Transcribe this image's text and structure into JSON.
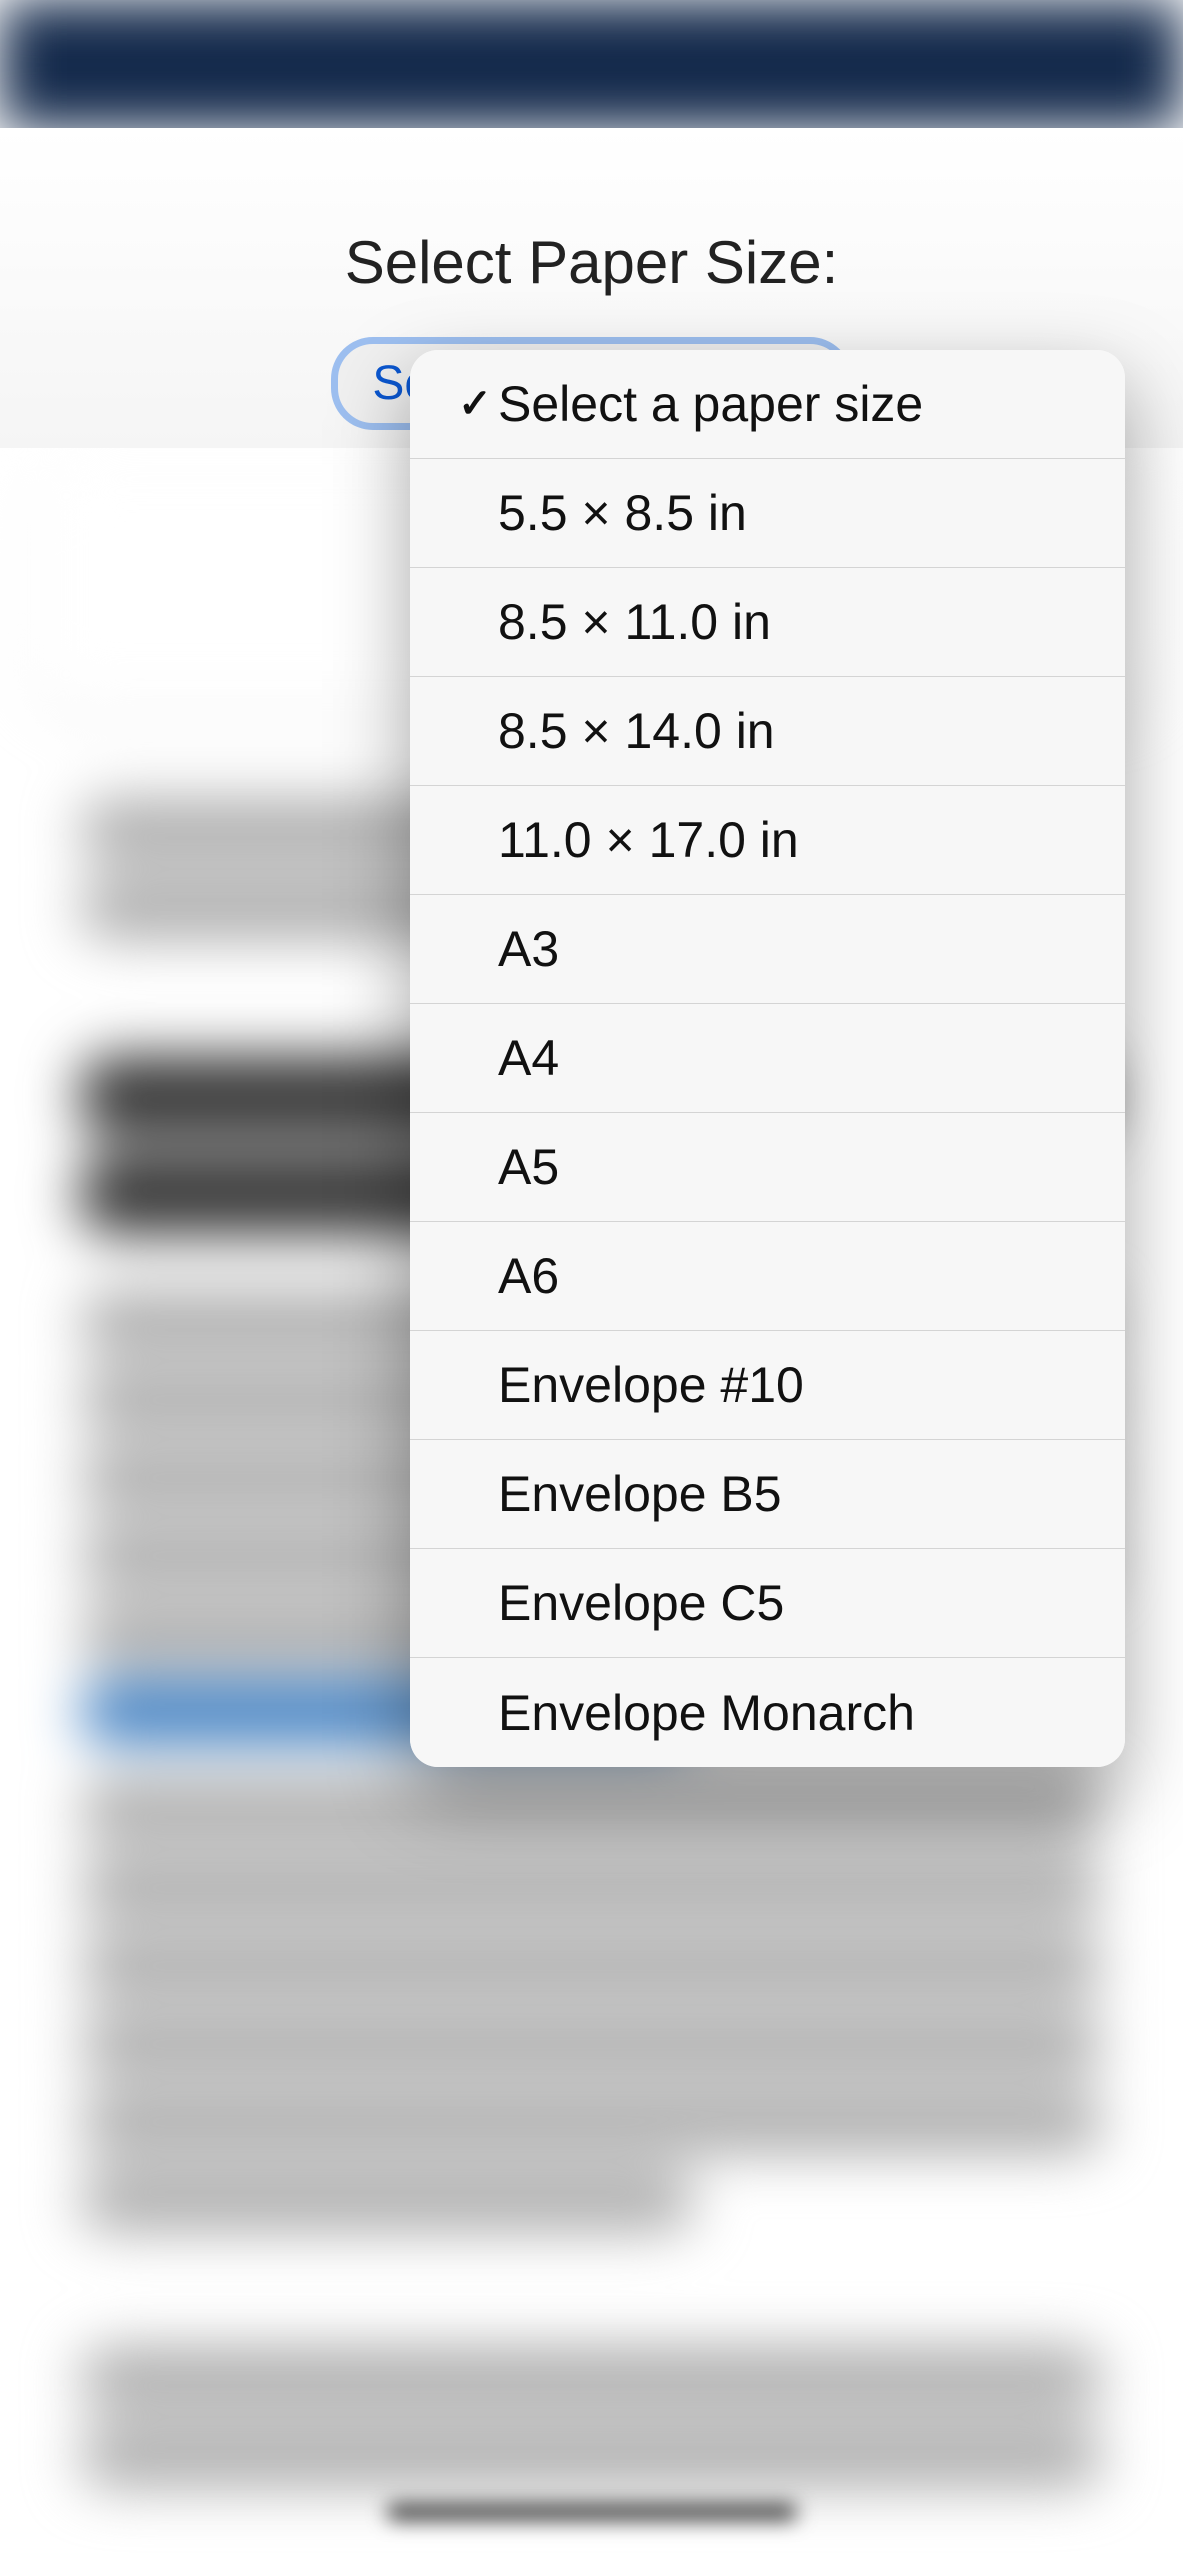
{
  "label": "Select Paper Size:",
  "selectButton": {
    "text": "Select a paper size"
  },
  "options": [
    {
      "label": "Select a paper size",
      "selected": true
    },
    {
      "label": "5.5 × 8.5 in",
      "selected": false
    },
    {
      "label": "8.5 × 11.0 in",
      "selected": false
    },
    {
      "label": "8.5 × 14.0 in",
      "selected": false
    },
    {
      "label": "11.0 × 17.0 in",
      "selected": false
    },
    {
      "label": "A3",
      "selected": false
    },
    {
      "label": "A4",
      "selected": false
    },
    {
      "label": "A5",
      "selected": false
    },
    {
      "label": "A6",
      "selected": false
    },
    {
      "label": "Envelope #10",
      "selected": false
    },
    {
      "label": "Envelope B5",
      "selected": false
    },
    {
      "label": "Envelope C5",
      "selected": false
    },
    {
      "label": "Envelope Monarch",
      "selected": false
    }
  ]
}
